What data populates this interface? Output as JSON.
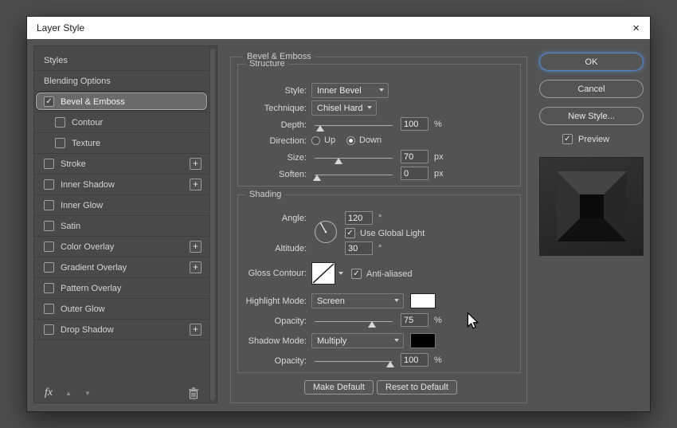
{
  "window": {
    "title": "Layer Style",
    "close_glyph": "×"
  },
  "icons": {
    "check": "✓",
    "plus": "+",
    "arrow_up": "▲",
    "arrow_down": "▼",
    "fx": "fx"
  },
  "sidebar": {
    "items": [
      {
        "label": "Styles"
      },
      {
        "label": "Blending Options"
      },
      {
        "label": "Bevel & Emboss",
        "checked": true,
        "selected": true
      },
      {
        "label": "Contour",
        "checked": false
      },
      {
        "label": "Texture",
        "checked": false
      },
      {
        "label": "Stroke",
        "checked": false,
        "has_add": true
      },
      {
        "label": "Inner Shadow",
        "checked": false,
        "has_add": true
      },
      {
        "label": "Inner Glow",
        "checked": false
      },
      {
        "label": "Satin",
        "checked": false
      },
      {
        "label": "Color Overlay",
        "checked": false,
        "has_add": true
      },
      {
        "label": "Gradient Overlay",
        "checked": false,
        "has_add": true
      },
      {
        "label": "Pattern Overlay",
        "checked": false
      },
      {
        "label": "Outer Glow",
        "checked": false
      },
      {
        "label": "Drop Shadow",
        "checked": false,
        "has_add": true
      }
    ]
  },
  "main": {
    "title": "Bevel & Emboss",
    "structure": {
      "legend": "Structure",
      "style": {
        "label": "Style:",
        "value": "Inner Bevel"
      },
      "technique": {
        "label": "Technique:",
        "value": "Chisel Hard"
      },
      "depth": {
        "label": "Depth:",
        "value": "100",
        "unit": "%"
      },
      "direction": {
        "label": "Direction:",
        "up": "Up",
        "down": "Down",
        "selected": "Down"
      },
      "size": {
        "label": "Size:",
        "value": "70",
        "unit": "px"
      },
      "soften": {
        "label": "Soften:",
        "value": "0",
        "unit": "px"
      }
    },
    "shading": {
      "legend": "Shading",
      "angle": {
        "label": "Angle:",
        "value": "120",
        "unit": "°"
      },
      "use_global_light": {
        "label": "Use Global Light",
        "checked": true
      },
      "altitude": {
        "label": "Altitude:",
        "value": "30",
        "unit": "°"
      },
      "gloss_contour": {
        "label": "Gloss Contour:"
      },
      "anti_aliased": {
        "label": "Anti-aliased",
        "checked": true
      },
      "highlight_mode": {
        "label": "Highlight Mode:",
        "value": "Screen",
        "swatch": "#ffffff"
      },
      "highlight_opacity": {
        "label": "Opacity:",
        "value": "75",
        "unit": "%"
      },
      "shadow_mode": {
        "label": "Shadow Mode:",
        "value": "Multiply",
        "swatch": "#000000"
      },
      "shadow_opacity": {
        "label": "Opacity:",
        "value": "100",
        "unit": "%"
      }
    },
    "footer_buttons": {
      "make_default": "Make Default",
      "reset_to_default": "Reset to Default"
    }
  },
  "actions": {
    "ok": "OK",
    "cancel": "Cancel",
    "new_style": "New Style...",
    "preview": "Preview"
  }
}
